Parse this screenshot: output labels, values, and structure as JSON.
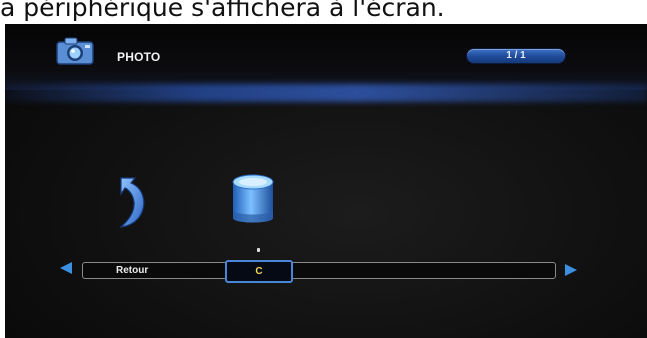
{
  "caption": "a périphérique s'affichera à l'écran.",
  "header": {
    "title": "PHOTO",
    "page_indicator": "1 / 1",
    "icon": "camera-icon"
  },
  "devices": {
    "items": [
      {
        "label": "Retour",
        "icon": "back-arrow-icon"
      },
      {
        "label": "C",
        "icon": "drive-icon",
        "selected": true
      }
    ]
  },
  "colors": {
    "accent": "#3d8fe0",
    "selected_text": "#f1d560",
    "background": "#101010"
  }
}
